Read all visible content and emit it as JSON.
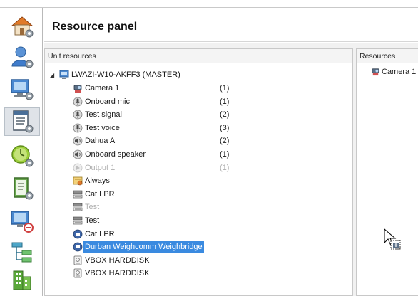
{
  "header": {
    "title": "Resource panel"
  },
  "sidebar": {
    "items": [
      {
        "name": "home"
      },
      {
        "name": "users"
      },
      {
        "name": "devices"
      },
      {
        "name": "resources",
        "active": true
      },
      {
        "name": "schedules"
      },
      {
        "name": "logs"
      },
      {
        "name": "network"
      },
      {
        "name": "tree"
      },
      {
        "name": "buildings"
      }
    ]
  },
  "unit_resources": {
    "header": "Unit resources",
    "root": "LWAZI-W10-AKFF3 (MASTER)",
    "items": [
      {
        "label": "Camera 1",
        "count": "(1)",
        "icon": "camera-icon"
      },
      {
        "label": "Onboard mic",
        "count": "(1)",
        "icon": "microphone-icon"
      },
      {
        "label": "Test signal",
        "count": "(2)",
        "icon": "microphone-icon"
      },
      {
        "label": "Test voice",
        "count": "(3)",
        "icon": "microphone-icon"
      },
      {
        "label": "Dahua A",
        "count": "(2)",
        "icon": "speaker-icon"
      },
      {
        "label": "Onboard speaker",
        "count": "(1)",
        "icon": "speaker-icon"
      },
      {
        "label": "Output 1",
        "count": "(1)",
        "icon": "output-icon",
        "disabled": true
      },
      {
        "label": "Always",
        "count": "",
        "icon": "schedule-icon"
      },
      {
        "label": "Cat LPR",
        "count": "",
        "icon": "lpr-icon"
      },
      {
        "label": "Test",
        "count": "",
        "icon": "lpr-icon",
        "disabled": true
      },
      {
        "label": "Test",
        "count": "",
        "icon": "lpr-icon"
      },
      {
        "label": "Cat LPR",
        "count": "",
        "icon": "lpr-blue-icon"
      },
      {
        "label": "Durban Weighcomm Weighbridge",
        "count": "",
        "icon": "weighbridge-icon",
        "selected": true
      },
      {
        "label": "VBOX HARDDISK",
        "count": "",
        "icon": "harddisk-icon"
      },
      {
        "label": "VBOX HARDDISK",
        "count": "",
        "icon": "harddisk-icon"
      }
    ]
  },
  "resources": {
    "header": "Resources",
    "items": [
      {
        "label": "Camera 1",
        "icon": "camera-icon"
      }
    ]
  }
}
